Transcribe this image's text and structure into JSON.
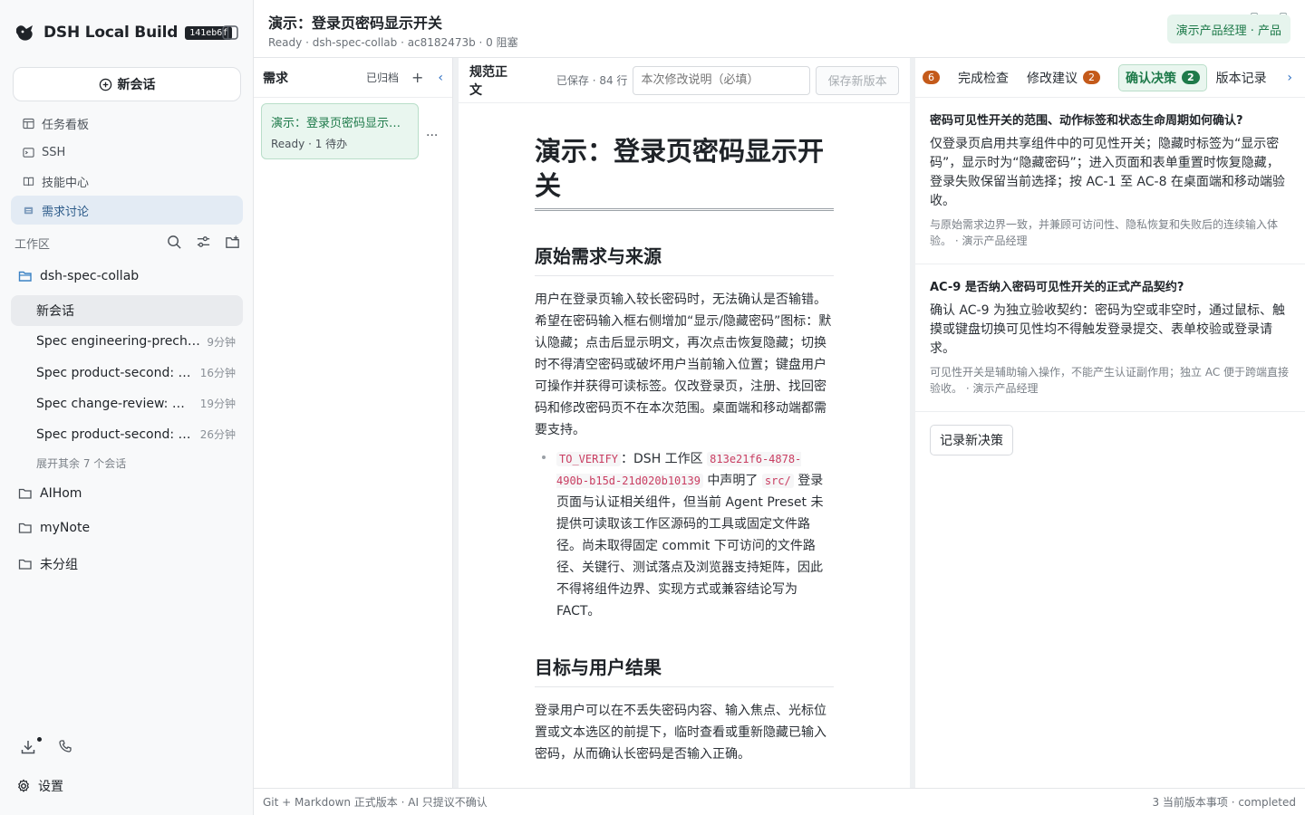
{
  "app": {
    "title": "DSH Local Build",
    "build_badge": "141eb6f",
    "new_chat": "新会话"
  },
  "nav": [
    {
      "label": "任务看板",
      "icon": "kanban-icon"
    },
    {
      "label": "SSH",
      "icon": "terminal-icon"
    },
    {
      "label": "技能中心",
      "icon": "book-icon"
    },
    {
      "label": "需求讨论",
      "icon": "doc-icon",
      "active": true
    }
  ],
  "workspace": {
    "label": "工作区",
    "project": "dsh-spec-collab",
    "conversations": [
      {
        "title": "新会话",
        "time": "",
        "active": true
      },
      {
        "title": "Spec engineering-precheck",
        "time": "9分钟"
      },
      {
        "title": "Spec product-second: 演示",
        "time": "16分钟"
      },
      {
        "title": "Spec change-review: 演示",
        "time": "19分钟"
      },
      {
        "title": "Spec product-second: 演示",
        "time": "26分钟"
      }
    ],
    "more": "展开其余 7 个会话",
    "folders": [
      "AIHom",
      "myNote",
      "未分组"
    ]
  },
  "settings_label": "设置",
  "header": {
    "title": "演示：登录页密码显示开关",
    "subtitle": "Ready · dsh-spec-collab · ac8182473b · 0 阻塞",
    "role": "演示产品经理 · 产品"
  },
  "requirements": {
    "label": "需求",
    "archived": "已归档",
    "add": "+",
    "collapse": "‹",
    "card": {
      "title": "演示：登录页密码显示开关",
      "status": "Ready · 1 待办"
    },
    "more": "···"
  },
  "spec": {
    "label": "规范正文",
    "saved": "已保存 · 84 行",
    "note_placeholder": "本次修改说明（必填）",
    "save_button": "保存新版本",
    "doc": {
      "h1": "演示：登录页密码显示开关",
      "h2_source": "原始需求与来源",
      "p_source": "用户在登录页输入较长密码时，无法确认是否输错。希望在密码输入框右侧增加“显示/隐藏密码”图标：默认隐藏；点击后显示明文，再次点击恢复隐藏；切换时不得清空密码或破坏用户当前输入位置；键盘用户可操作并获得可读标签。仅改登录页，注册、找回密码和修改密码页不在本次范围。桌面端和移动端都需要支持。",
      "bullet_code1": "TO_VERIFY",
      "bullet_t1": "：DSH 工作区 ",
      "bullet_code2": "813e21f6-4878-490b-b15d-21d020b10139",
      "bullet_t2": " 中声明了 ",
      "bullet_code3": "src/",
      "bullet_t3": " 登录页面与认证相关组件，但当前 Agent Preset 未提供可读取该工作区源码的工具或固定文件路径。尚未取得固定 commit 下可访问的文件路径、关键行、测试落点及浏览器支持矩阵，因此不得将组件边界、实现方式或兼容结论写为 FACT。",
      "h2_goal": "目标与用户结果",
      "p_goal": "登录用户可以在不丢失密码内容、输入焦点、光标位置或文本选区的前提下，临时查看或重新隐藏已输入密码，从而确认长密码是否输入正确。"
    }
  },
  "right_panel": {
    "tabs": [
      {
        "label": "",
        "count": "6",
        "lead": true
      },
      {
        "label": "完成检查"
      },
      {
        "label": "修改建议",
        "count": "2"
      },
      {
        "label": "确认决策",
        "count": "2",
        "active": true
      },
      {
        "label": "版本记录"
      }
    ],
    "next": "›",
    "decisions": [
      {
        "question": "密码可见性开关的范围、动作标签和状态生命周期如何确认?",
        "answer": "仅登录页启用共享组件中的可见性开关；隐藏时标签为“显示密码”，显示时为“隐藏密码”；进入页面和表单重置时恢复隐藏，登录失败保留当前选择；按 AC-1 至 AC-8 在桌面端和移动端验收。",
        "reason": "与原始需求边界一致，并兼顾可访问性、隐私恢复和失败后的连续输入体验。 · 演示产品经理"
      },
      {
        "question": "AC-9 是否纳入密码可见性开关的正式产品契约?",
        "answer": "确认 AC-9 为独立验收契约：密码为空或非空时，通过鼠标、触摸或键盘切换可见性均不得触发登录提交、表单校验或登录请求。",
        "reason": "可见性开关是辅助输入操作，不能产生认证副作用；独立 AC 便于跨端直接验收。 · 演示产品经理"
      }
    ],
    "record_button": "记录新决策"
  },
  "footer": {
    "left": "Git + Markdown 正式版本 · AI 只提议不确认",
    "right": "3 当前版本事项 · completed"
  },
  "colors": {
    "accent_green": "#1e7a4a",
    "accent_blue": "#2d5b8a",
    "badge_orange": "#c45a1a"
  }
}
